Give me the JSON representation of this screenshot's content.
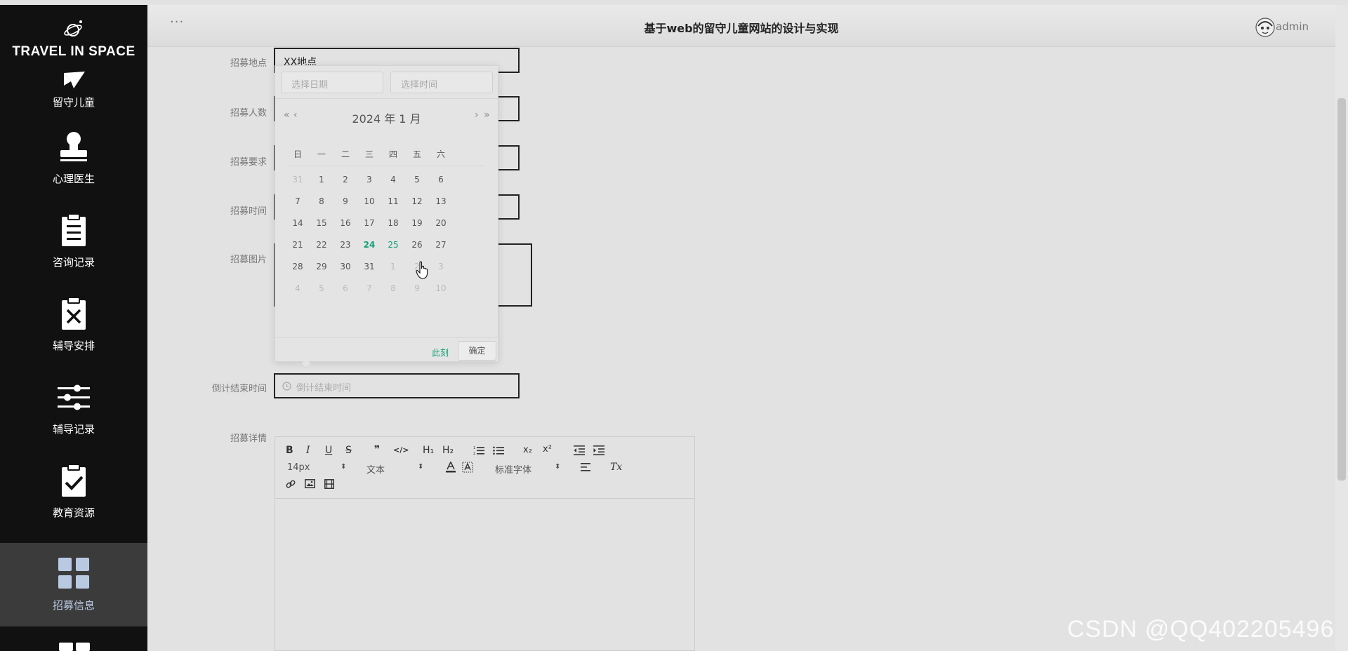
{
  "brand": {
    "name": "TRAVEL IN SPACE"
  },
  "sidebar": {
    "items": [
      {
        "label": "留守儿童",
        "icon": "paper-plane-icon"
      },
      {
        "label": "心理医生",
        "icon": "stamp-icon"
      },
      {
        "label": "咨询记录",
        "icon": "clipboard-icon"
      },
      {
        "label": "辅导安排",
        "icon": "clipboard-x-icon"
      },
      {
        "label": "辅导记录",
        "icon": "sliders-icon"
      },
      {
        "label": "教育资源",
        "icon": "clipboard-check-icon"
      },
      {
        "label": "招募信息",
        "icon": "grid-icon",
        "active": true
      }
    ]
  },
  "header": {
    "menu_dots": "···",
    "title": "基于web的留守儿童网站的设计与实现",
    "username": "admin"
  },
  "form": {
    "location_label": "招募地点",
    "location_value": "XX地点",
    "count_label": "招募人数",
    "requirement_label": "招募要求",
    "time_label": "招募时间",
    "image_label": "招募图片",
    "countdown_label": "倒计结束时间",
    "countdown_placeholder": "倒计结束时间",
    "details_label": "招募详情"
  },
  "datepicker": {
    "date_placeholder": "选择日期",
    "time_placeholder": "选择时间",
    "prev_year": "«",
    "prev_month": "‹",
    "next_month": "›",
    "next_year": "»",
    "month_title": "2024 年  1 月",
    "weekdays": [
      "日",
      "一",
      "二",
      "三",
      "四",
      "五",
      "六"
    ],
    "weeks": [
      [
        "31",
        "1",
        "2",
        "3",
        "4",
        "5",
        "6"
      ],
      [
        "7",
        "8",
        "9",
        "10",
        "11",
        "12",
        "13"
      ],
      [
        "14",
        "15",
        "16",
        "17",
        "18",
        "19",
        "20"
      ],
      [
        "21",
        "22",
        "23",
        "24",
        "25",
        "26",
        "27"
      ],
      [
        "28",
        "29",
        "30",
        "31",
        "1",
        "2",
        "3"
      ],
      [
        "4",
        "5",
        "6",
        "7",
        "8",
        "9",
        "10"
      ]
    ],
    "today": "24",
    "hovered": "25",
    "now_label": "此刻",
    "confirm_label": "确定"
  },
  "editor": {
    "bold": "B",
    "italic": "I",
    "underline": "U",
    "strike": "S",
    "quote": "❞",
    "code": "</>",
    "h1": "H₁",
    "h2": "H₂",
    "subscript": "x₂",
    "superscript": "x²",
    "size_value": "14px",
    "header_value": "文本",
    "font_value": "标准字体",
    "clean": "Tx"
  },
  "watermark": "CSDN @QQ402205496"
}
